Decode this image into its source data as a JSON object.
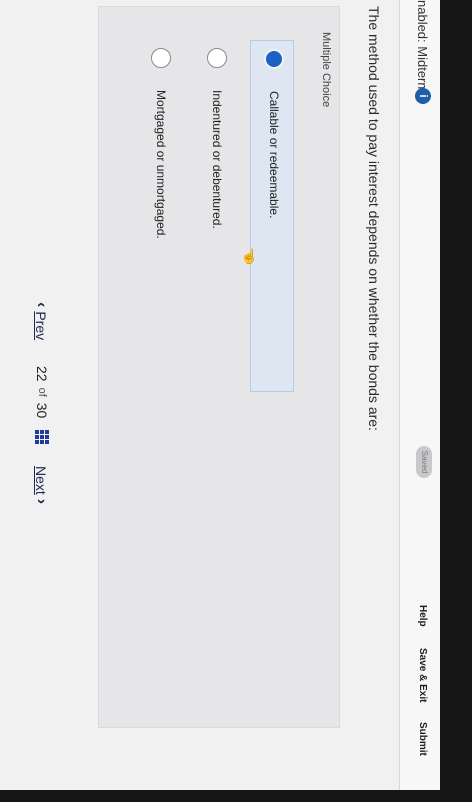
{
  "header": {
    "title": "nabled: Midterm I",
    "info_icon": "i",
    "saved_label": "Saved",
    "help_label": "Help",
    "save_exit_label": "Save & Exit",
    "submit_label": "Submit"
  },
  "question": {
    "text": "The method used to pay interest depends on whether the bonds are:",
    "type_label": "Multiple Choice",
    "options": [
      {
        "label": "Callable or redeemable.",
        "selected": true
      },
      {
        "label": "Indentured or debentured.",
        "selected": false
      },
      {
        "label": "Mortgaged or unmortgaged.",
        "selected": false
      }
    ]
  },
  "footer": {
    "prev_label": "Prev",
    "current_page": "22",
    "of_label": "of",
    "total_pages": "30",
    "next_label": "Next"
  },
  "colors": {
    "accent": "#1c62c4",
    "nav_text": "#1e2a55"
  }
}
